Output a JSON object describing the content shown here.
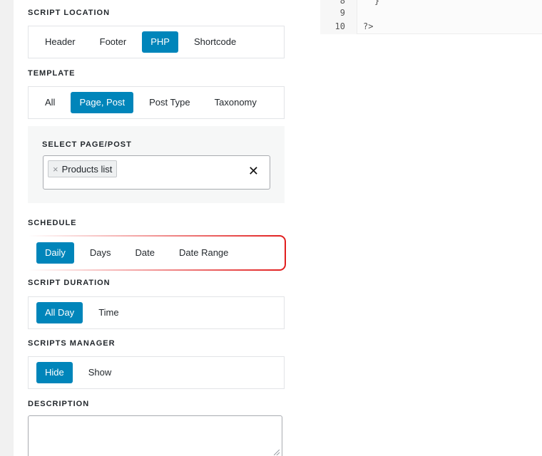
{
  "code_editor": {
    "lines": [
      {
        "num": "8",
        "text": "}"
      },
      {
        "num": "9",
        "text": ""
      },
      {
        "num": "10",
        "text": "?>"
      }
    ]
  },
  "script_location": {
    "label": "SCRIPT LOCATION",
    "options": [
      "Header",
      "Footer",
      "PHP",
      "Shortcode"
    ],
    "selected": "PHP"
  },
  "template": {
    "label": "TEMPLATE",
    "options": [
      "All",
      "Page, Post",
      "Post Type",
      "Taxonomy"
    ],
    "selected": "Page, Post"
  },
  "select_page_post": {
    "label": "SELECT PAGE/POST",
    "chips": [
      "Products list"
    ],
    "remove_chip_glyph": "×",
    "clear_glyph": "✕"
  },
  "schedule": {
    "label": "SCHEDULE",
    "options": [
      "Daily",
      "Days",
      "Date",
      "Date Range"
    ],
    "selected": "Daily"
  },
  "script_duration": {
    "label": "SCRIPT DURATION",
    "options": [
      "All Day",
      "Time"
    ],
    "selected": "All Day"
  },
  "scripts_manager": {
    "label": "SCRIPTS MANAGER",
    "options": [
      "Hide",
      "Show"
    ],
    "selected": "Hide"
  },
  "description": {
    "label": "DESCRIPTION",
    "value": ""
  },
  "colors": {
    "accent": "#0085ba",
    "highlight": "#e11d1d"
  }
}
